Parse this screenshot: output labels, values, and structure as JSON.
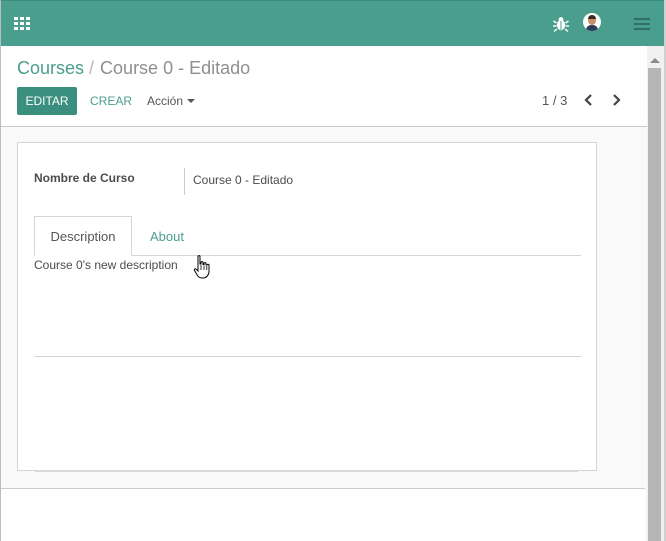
{
  "topbar": {
    "apps_icon": "apps-grid-icon",
    "debug_icon": "bug-icon",
    "avatar_icon": "user-avatar",
    "menu_icon": "hamburger-menu-icon",
    "color": "#4a9e8e"
  },
  "breadcrumb": {
    "parent": "Courses",
    "separator": "/",
    "current": "Course 0 - Editado"
  },
  "toolbar": {
    "edit_label": "EDITAR",
    "create_label": "CREAR",
    "action_label": "Acción"
  },
  "pager": {
    "value": "1 / 3"
  },
  "form": {
    "name_label": "Nombre de Curso",
    "name_value": "Course 0 - Editado",
    "tabs": [
      {
        "label": "Description",
        "active": true
      },
      {
        "label": "About",
        "active": false
      }
    ],
    "description_text": "Course 0's  new description"
  }
}
